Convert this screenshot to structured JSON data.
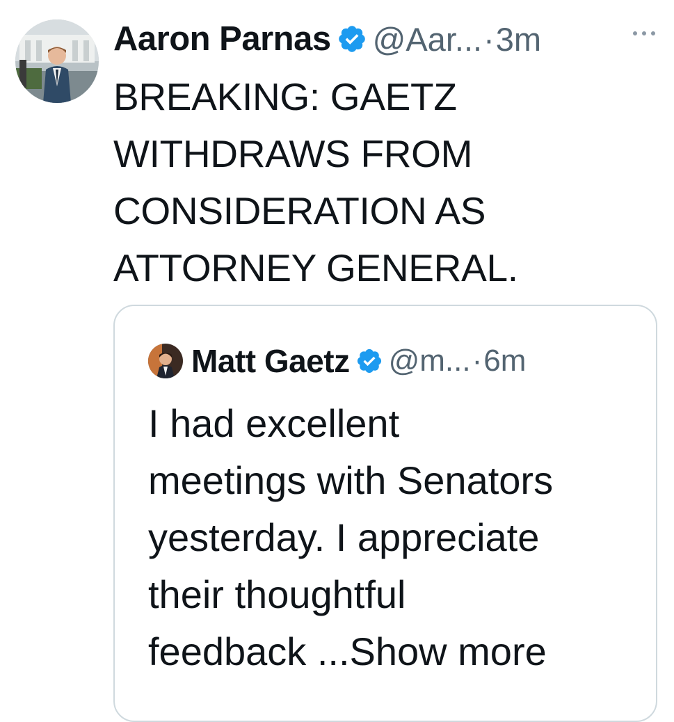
{
  "tweet": {
    "author_name": "Aaron Parnas",
    "handle": "@Aar...",
    "separator": "·",
    "time": "3m",
    "more_icon": "more-horizontal-icon",
    "text_lines": [
      "BREAKING: GAETZ",
      "WITHDRAWS FROM",
      "CONSIDERATION AS",
      "ATTORNEY GENERAL."
    ],
    "verified_icon": "verified-badge-icon",
    "verified_color": "#1d9bf0"
  },
  "quote": {
    "author_name": "Matt Gaetz",
    "handle": "@m...",
    "separator": "·",
    "time": "6m",
    "text_lines": [
      "I had excellent",
      "meetings with Senators",
      "yesterday.  I appreciate",
      "their thoughtful"
    ],
    "last_line_text": "feedback ...",
    "show_more": "Show more"
  }
}
